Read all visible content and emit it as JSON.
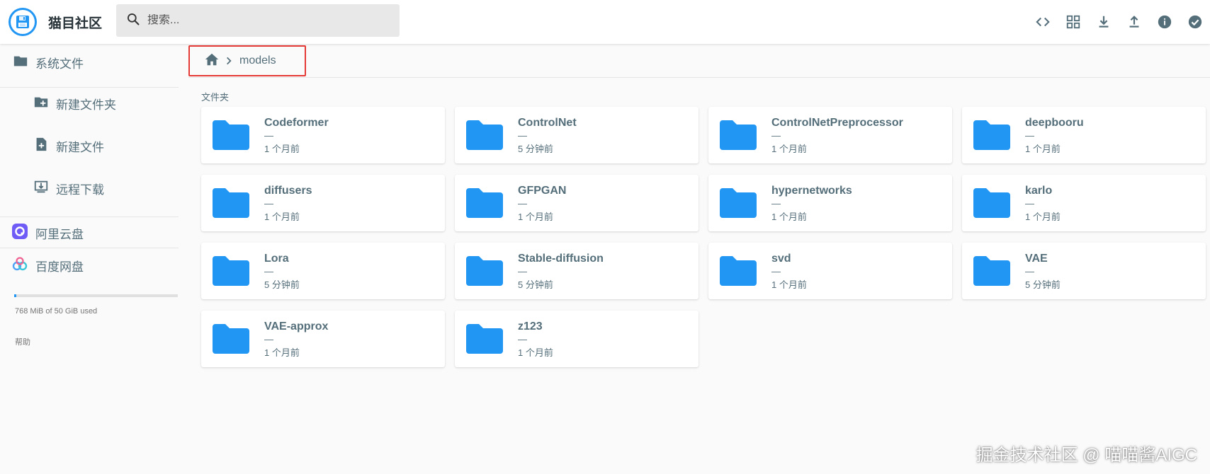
{
  "header": {
    "app_title": "猫目社区",
    "search_placeholder": "搜索...",
    "tools": [
      "code-icon",
      "grid-view-icon",
      "download-icon",
      "upload-icon",
      "info-icon",
      "check-circle-icon"
    ]
  },
  "sidebar": {
    "items": [
      {
        "label": "系统文件",
        "icon": "folder-icon"
      },
      {
        "label": "新建文件夹",
        "icon": "create-folder-icon"
      },
      {
        "label": "新建文件",
        "icon": "new-file-icon"
      },
      {
        "label": "远程下载",
        "icon": "remote-download-icon"
      },
      {
        "label": "阿里云盘",
        "icon": "aliyun-drive-icon"
      },
      {
        "label": "百度网盘",
        "icon": "baidu-netdisk-icon"
      }
    ],
    "quota": {
      "text": "768 MiB of 50 GiB used",
      "fraction": 0.015
    },
    "help": "帮助"
  },
  "breadcrumb": {
    "current": "models"
  },
  "section_label": "文件夹",
  "folders": [
    {
      "name": "Codeformer",
      "size": "—",
      "modified": "1 个月前"
    },
    {
      "name": "ControlNet",
      "size": "—",
      "modified": "5 分钟前"
    },
    {
      "name": "ControlNetPreprocessor",
      "size": "—",
      "modified": "1 个月前"
    },
    {
      "name": "deepbooru",
      "size": "—",
      "modified": "1 个月前"
    },
    {
      "name": "diffusers",
      "size": "—",
      "modified": "1 个月前"
    },
    {
      "name": "GFPGAN",
      "size": "—",
      "modified": "1 个月前"
    },
    {
      "name": "hypernetworks",
      "size": "—",
      "modified": "1 个月前"
    },
    {
      "name": "karlo",
      "size": "—",
      "modified": "1 个月前"
    },
    {
      "name": "Lora",
      "size": "—",
      "modified": "5 分钟前"
    },
    {
      "name": "Stable-diffusion",
      "size": "—",
      "modified": "5 分钟前"
    },
    {
      "name": "svd",
      "size": "—",
      "modified": "1 个月前"
    },
    {
      "name": "VAE",
      "size": "—",
      "modified": "5 分钟前"
    },
    {
      "name": "VAE-approx",
      "size": "—",
      "modified": "1 个月前"
    },
    {
      "name": "z123",
      "size": "—",
      "modified": "1 个月前"
    }
  ],
  "watermark": "掘金技术社区 @ 喵喵酱AIGC",
  "colors": {
    "accent": "#2196f3",
    "text": "#546e7a",
    "highlight_border": "#e53935"
  }
}
